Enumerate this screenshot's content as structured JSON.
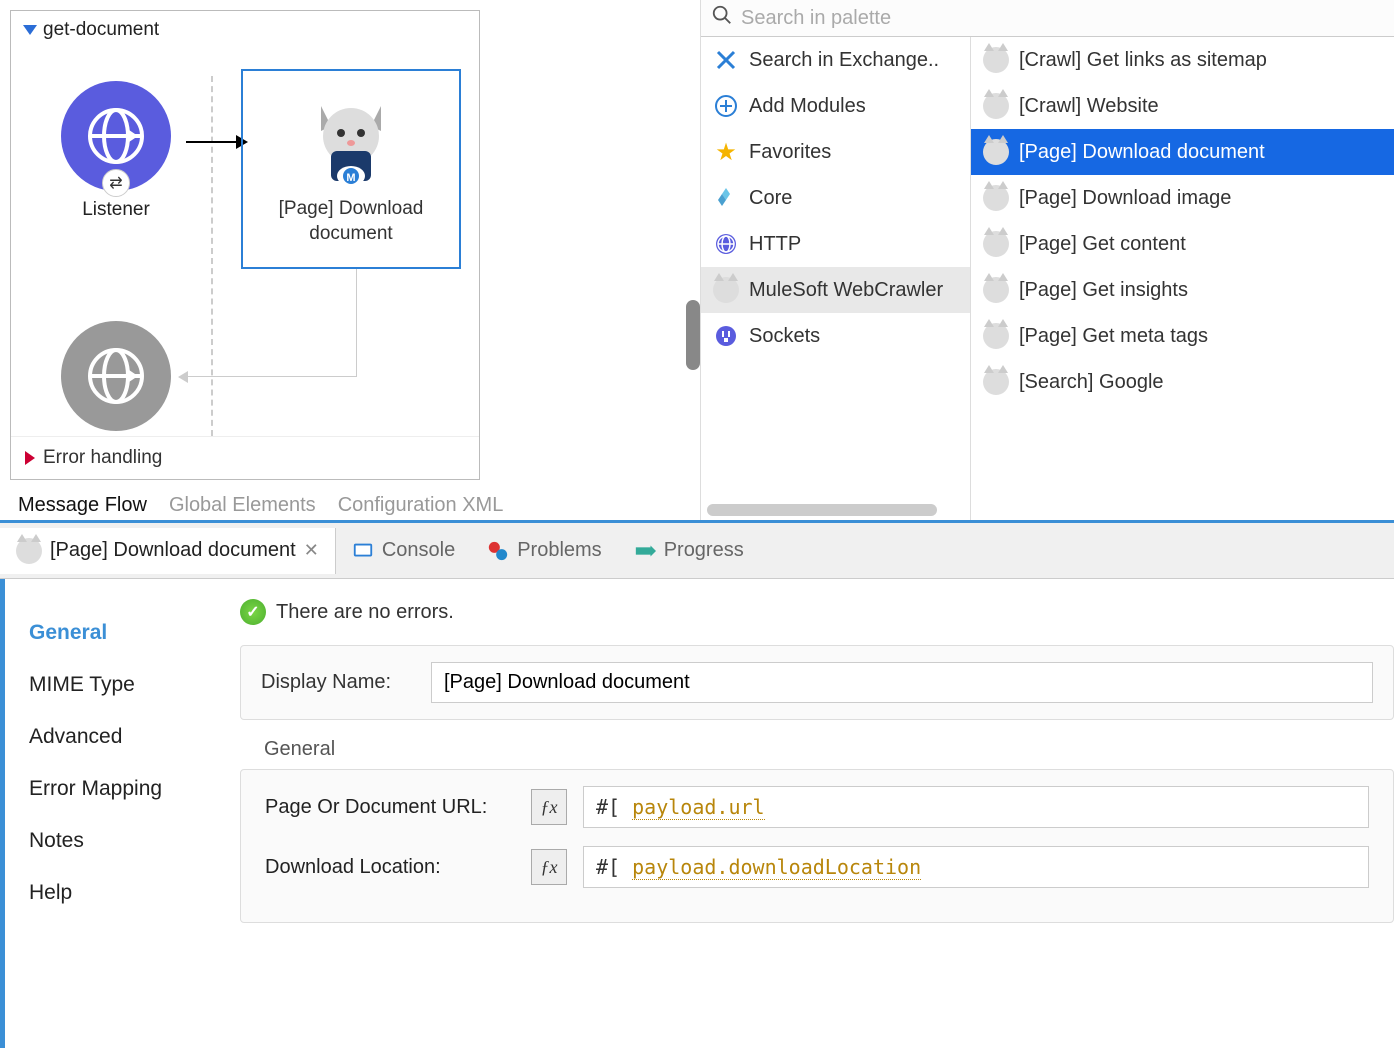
{
  "flow": {
    "name": "get-document",
    "listener_label": "Listener",
    "download_label": "[Page] Download document",
    "error_label": "Error handling"
  },
  "canvas_tabs": {
    "active": "Message Flow",
    "t2": "Global Elements",
    "t3": "Configuration XML"
  },
  "palette": {
    "search_placeholder": "Search in palette",
    "left": [
      {
        "label": "Search in Exchange..",
        "icon": "exchange"
      },
      {
        "label": "Add Modules",
        "icon": "plus"
      },
      {
        "label": "Favorites",
        "icon": "star"
      },
      {
        "label": "Core",
        "icon": "core"
      },
      {
        "label": "HTTP",
        "icon": "http"
      },
      {
        "label": "MuleSoft WebCrawler",
        "icon": "cat",
        "selected": true
      },
      {
        "label": "Sockets",
        "icon": "socket"
      }
    ],
    "right": [
      {
        "label": "[Crawl] Get links as sitemap"
      },
      {
        "label": "[Crawl] Website"
      },
      {
        "label": "[Page] Download document",
        "selected": true
      },
      {
        "label": "[Page] Download image"
      },
      {
        "label": "[Page] Get content"
      },
      {
        "label": "[Page] Get insights"
      },
      {
        "label": "[Page] Get meta tags"
      },
      {
        "label": "[Search] Google"
      }
    ]
  },
  "bottom_tabs": {
    "active": "[Page] Download document",
    "console": "Console",
    "problems": "Problems",
    "progress": "Progress"
  },
  "props": {
    "sidebar": [
      "General",
      "MIME Type",
      "Advanced",
      "Error Mapping",
      "Notes",
      "Help"
    ],
    "status": "There are no errors.",
    "display_name_label": "Display Name:",
    "display_name_value": "[Page] Download document",
    "section": "General",
    "url_label": "Page Or Document URL:",
    "url_prefix": "#[",
    "url_value": "payload.url",
    "loc_label": "Download Location:",
    "loc_prefix": "#[",
    "loc_value": "payload.downloadLocation"
  }
}
